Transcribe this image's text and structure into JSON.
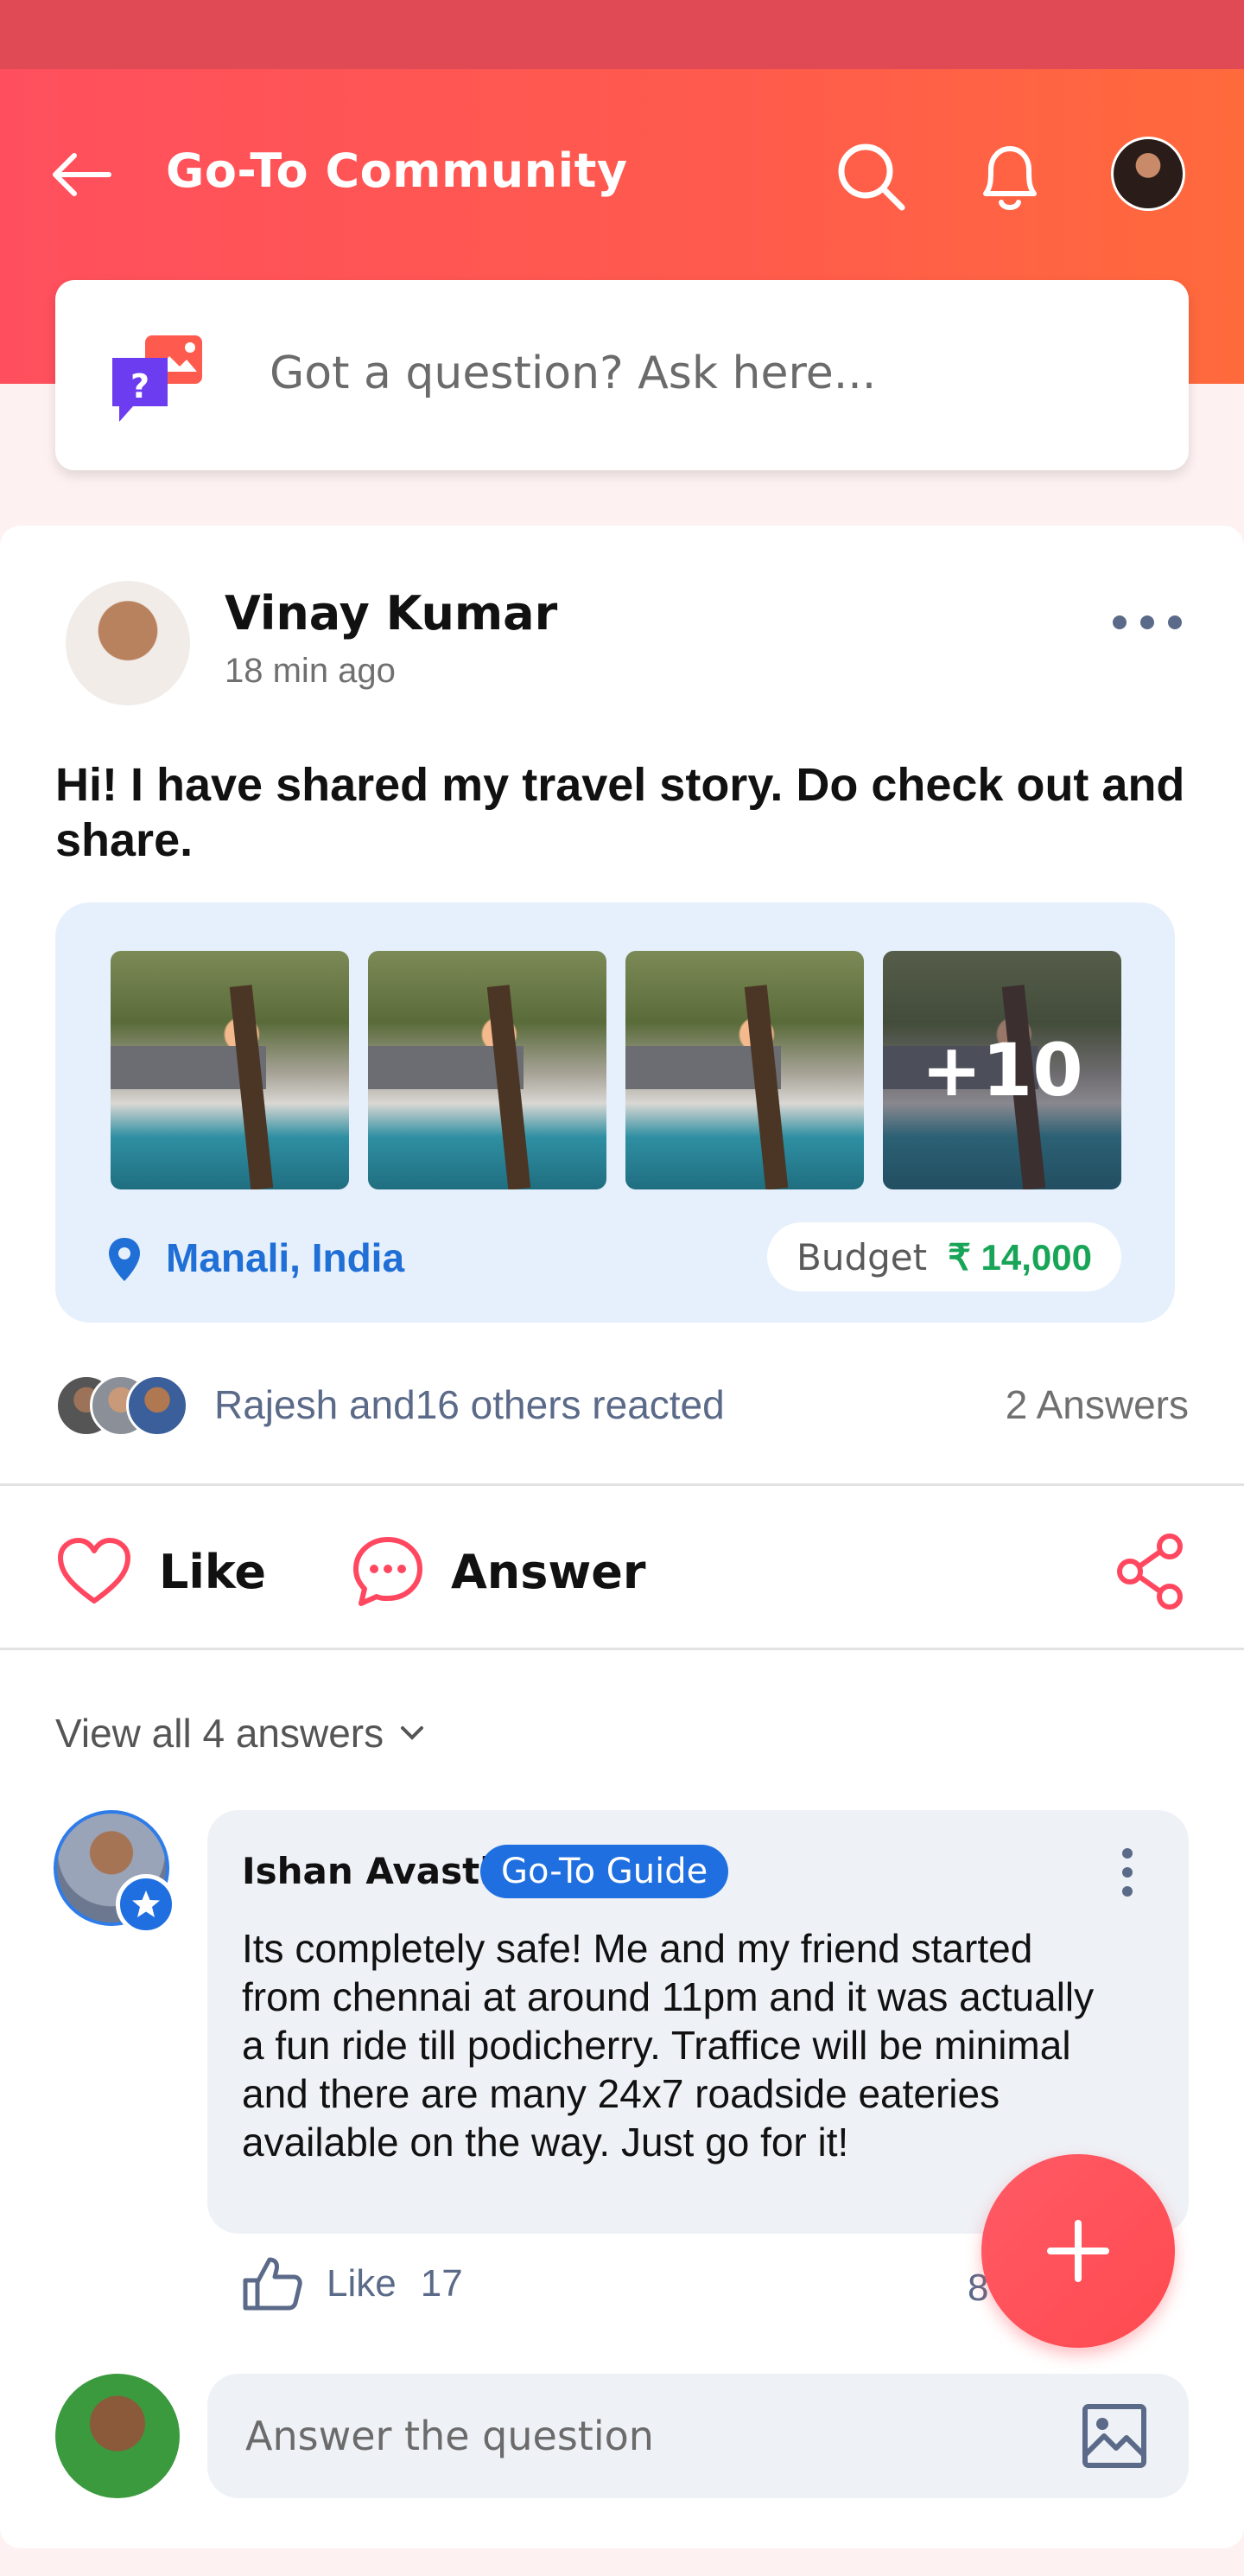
{
  "header": {
    "title": "Go-To Community",
    "gradient_start": "#ff4f5e",
    "gradient_end": "#ff6a3c"
  },
  "ask": {
    "placeholder": "Got a question? Ask here..."
  },
  "post": {
    "author": "Vinay Kumar",
    "time": "18 min ago",
    "text": "Hi! I have shared my travel story. Do check out and share.",
    "photos_more": "+10",
    "location": "Manali, India",
    "budget_label": "Budget",
    "budget_value": "₹ 14,000",
    "reactions_text": "Rajesh and16 others reacted",
    "answers_count": "2 Answers",
    "like_label": "Like",
    "answer_label": "Answer",
    "view_all": "View all 4 answers"
  },
  "answer": {
    "name": "Ishan Avasti",
    "tag": "Go-To Guide",
    "text": "Its completely safe! Me and my friend started from chennai at around 11pm and it was actually a fun ride till podicherry. Traffice will be minimal and there are many 24x7 roadside eateries available on the way. Just go for it!",
    "like_label": "Like",
    "like_count": "17",
    "right_count": "8"
  },
  "composer": {
    "placeholder": "Answer the question"
  },
  "colors": {
    "accent": "#ff4f5e",
    "link_blue": "#1f6fd6",
    "budget_green": "#18a558"
  }
}
